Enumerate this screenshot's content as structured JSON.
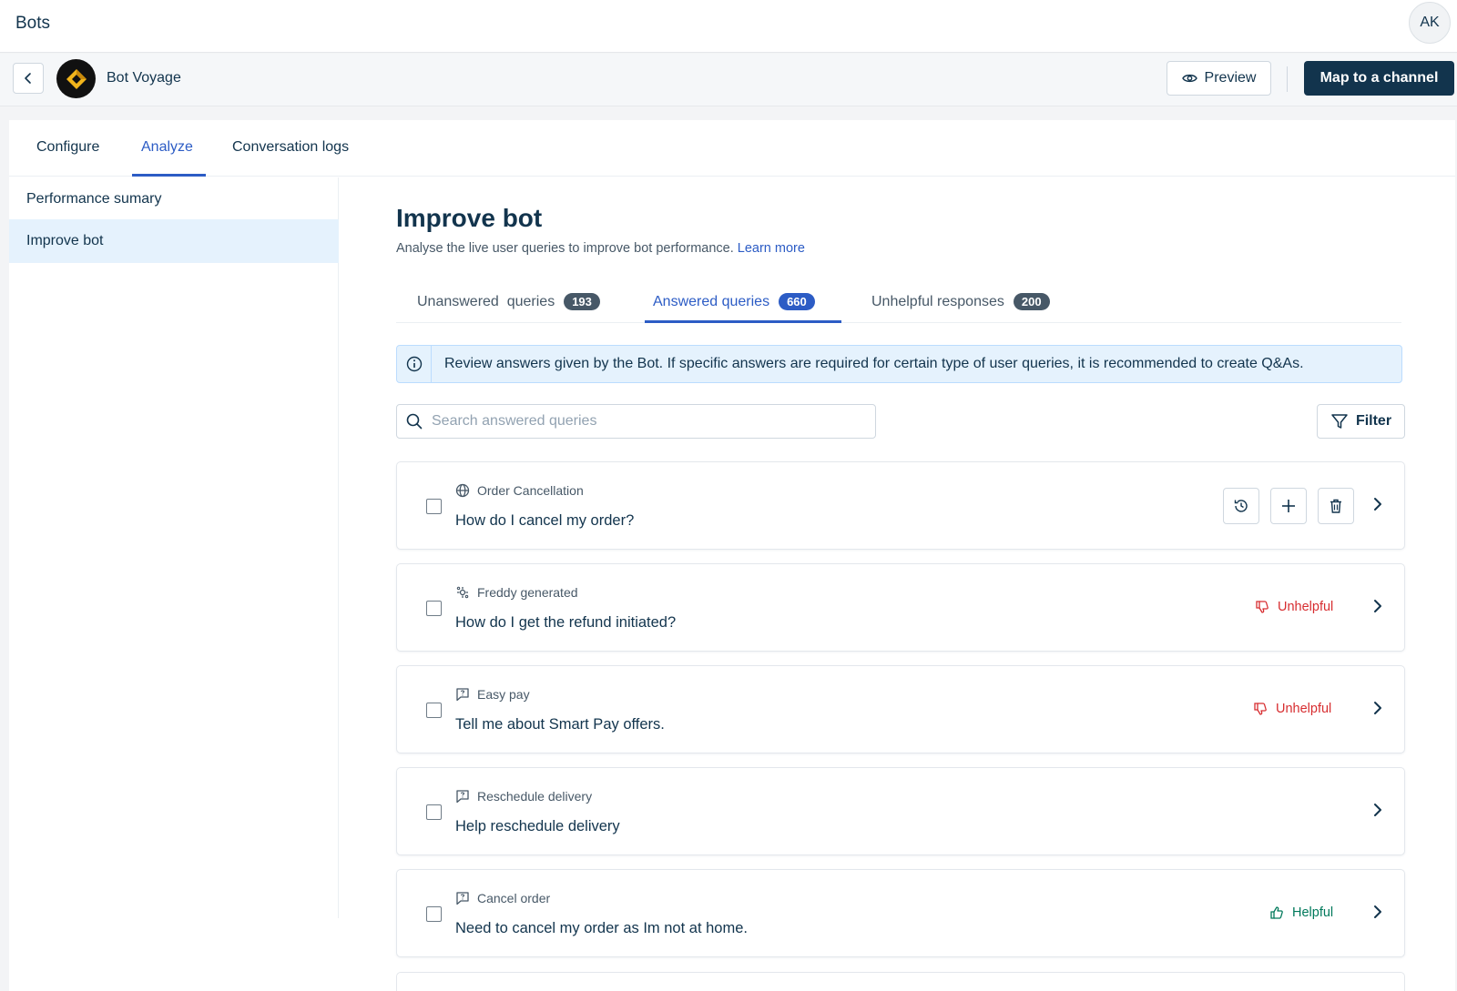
{
  "header": {
    "title": "Bots",
    "avatar_initials": "AK"
  },
  "bot_bar": {
    "bot_name": "Bot Voyage",
    "preview_label": "Preview",
    "map_label": "Map to a channel"
  },
  "main_tabs": [
    {
      "label": "Configure"
    },
    {
      "label": "Analyze",
      "active": true
    },
    {
      "label": "Conversation logs"
    }
  ],
  "sidebar": {
    "items": [
      {
        "label": "Performance sumary"
      },
      {
        "label": "Improve bot",
        "active": true
      }
    ]
  },
  "content": {
    "title": "Improve bot",
    "subtitle": "Analyse the live user queries to improve bot performance.",
    "learn_more": "Learn more",
    "sub_tabs": [
      {
        "label": "Unanswered  queries",
        "count": "193"
      },
      {
        "label": "Answered queries",
        "count": "660",
        "active": true
      },
      {
        "label": "Unhelpful responses",
        "count": "200"
      }
    ],
    "info_banner": "Review answers given by the Bot. If specific answers are required for certain type of user queries, it is recommended to create Q&As.",
    "search_placeholder": "Search answered queries",
    "filter_label": "Filter"
  },
  "queries": [
    {
      "source_icon": "globe-icon",
      "source": "Order Cancellation",
      "query": "How do I cancel my order?",
      "status": "",
      "actions": [
        "history-icon",
        "plus-icon",
        "trash-icon"
      ]
    },
    {
      "source_icon": "freddy-icon",
      "source": "Freddy generated",
      "query": "How do I get the refund initiated?",
      "status": "Unhelpful"
    },
    {
      "source_icon": "chat-icon",
      "source": "Easy pay",
      "query": "Tell me about Smart Pay offers.",
      "status": "Unhelpful"
    },
    {
      "source_icon": "chat-icon",
      "source": "Reschedule delivery",
      "query": "Help reschedule delivery",
      "status": ""
    },
    {
      "source_icon": "chat-icon",
      "source": "Cancel order",
      "query": "Need to cancel my order as Im not at home.",
      "status": "Helpful"
    }
  ],
  "colors": {
    "primary_dark": "#12344d",
    "accent_blue": "#2c5cc5",
    "unhelpful_red": "#d72d30",
    "helpful_green": "#00795b",
    "banner_bg": "#e5f2fd"
  }
}
